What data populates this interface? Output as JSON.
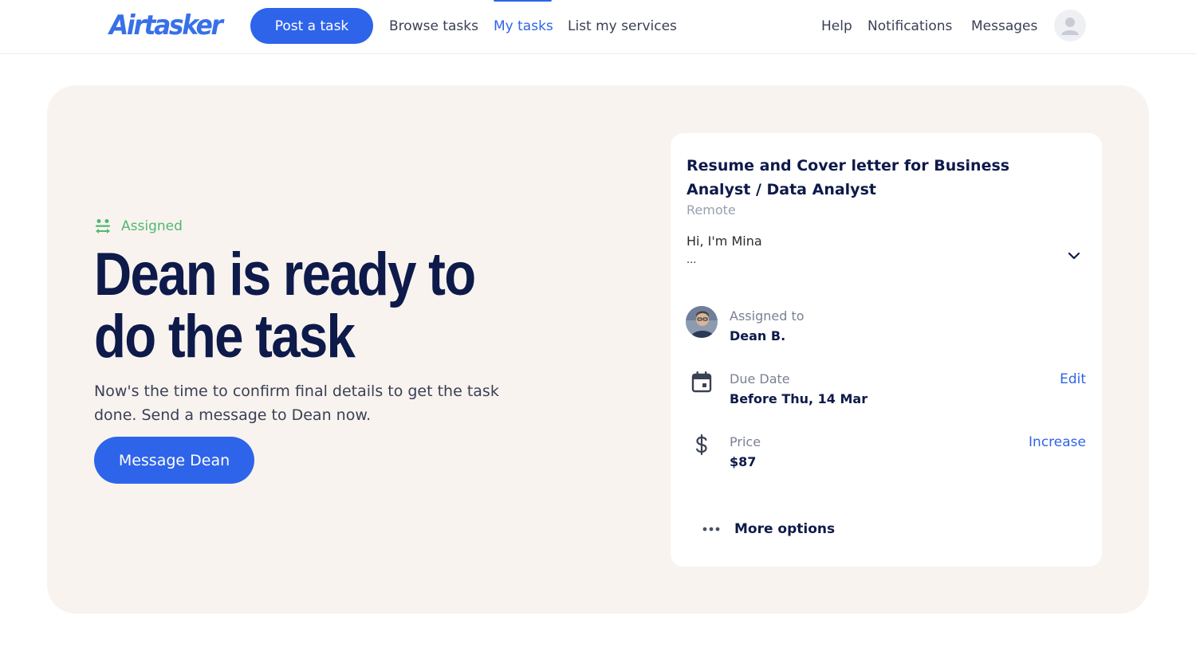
{
  "header": {
    "logo": "Airtasker",
    "post_task": "Post a task",
    "nav": {
      "browse": "Browse tasks",
      "my_tasks": "My tasks",
      "list_services": "List my services",
      "help": "Help",
      "notifications": "Notifications",
      "messages": "Messages"
    }
  },
  "hero": {
    "status": "Assigned",
    "title": "Dean is ready to do the task",
    "description": "Now's the time to confirm final details to get the task done. Send a message to Dean now.",
    "cta": "Message Dean"
  },
  "task": {
    "title": "Resume and Cover letter for Business Analyst / Data Analyst",
    "location": "Remote",
    "description": "Hi, I'm Mina",
    "ellipsis": "...",
    "assigned_label": "Assigned to",
    "assigned_value": "Dean B.",
    "due_label": "Due Date",
    "due_value": "Before Thu, 14 Mar",
    "due_action": "Edit",
    "price_label": "Price",
    "price_value": "$87",
    "price_action": "Increase",
    "more_options": "More options"
  },
  "colors": {
    "primary": "#2e64ea",
    "hero_bg": "#f8f3ef",
    "navy": "#0d1a4a",
    "success": "#4fb872"
  }
}
